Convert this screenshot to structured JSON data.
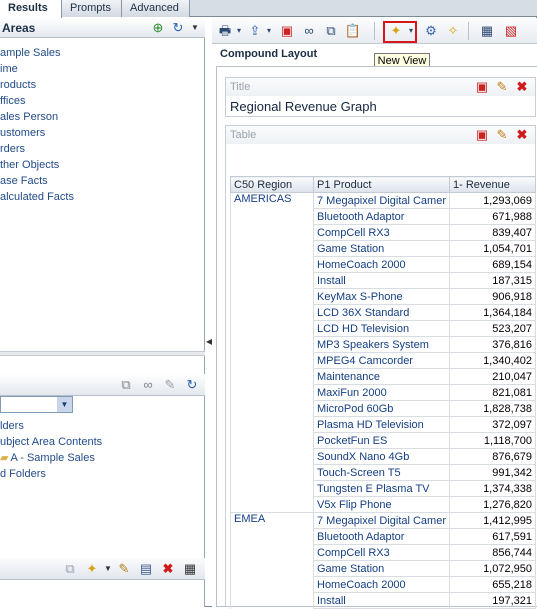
{
  "tabs": [
    {
      "label": "Results"
    },
    {
      "label": "Prompts"
    },
    {
      "label": "Advanced"
    }
  ],
  "left_panel": {
    "subject_areas_title": "Areas",
    "subject_area_items": [
      "ample Sales",
      "ime",
      "roducts",
      "ffices",
      "ales Person",
      "ustomers",
      "rders",
      "ther Objects",
      "ase Facts",
      "alculated Facts"
    ],
    "catalog_items": [
      "lders",
      "ubject Area Contents",
      "A - Sample Sales",
      "d Folders"
    ]
  },
  "toolbar": {
    "tooltip": "New View"
  },
  "compound_layout": {
    "title": "Compound Layout",
    "title_view": {
      "label": "Title",
      "text": "Regional Revenue Graph"
    },
    "table_view": {
      "label": "Table"
    }
  },
  "table": {
    "columns": [
      "C50 Region",
      "P1 Product",
      "1- Revenue"
    ],
    "groups": [
      {
        "region": "AMERICAS",
        "rows": [
          {
            "product": "7 Megapixel Digital Camer",
            "revenue": "1,293,069"
          },
          {
            "product": "Bluetooth Adaptor",
            "revenue": "671,988"
          },
          {
            "product": "CompCell RX3",
            "revenue": "839,407"
          },
          {
            "product": "Game Station",
            "revenue": "1,054,701"
          },
          {
            "product": "HomeCoach 2000",
            "revenue": "689,154"
          },
          {
            "product": "Install",
            "revenue": "187,315"
          },
          {
            "product": "KeyMax S-Phone",
            "revenue": "906,918"
          },
          {
            "product": "LCD 36X Standard",
            "revenue": "1,364,184"
          },
          {
            "product": "LCD HD Television",
            "revenue": "523,207"
          },
          {
            "product": "MP3 Speakers System",
            "revenue": "376,816"
          },
          {
            "product": "MPEG4 Camcorder",
            "revenue": "1,340,402"
          },
          {
            "product": "Maintenance",
            "revenue": "210,047"
          },
          {
            "product": "MaxiFun 2000",
            "revenue": "821,081"
          },
          {
            "product": "MicroPod 60Gb",
            "revenue": "1,828,738"
          },
          {
            "product": "Plasma HD Television",
            "revenue": "372,097"
          },
          {
            "product": "PocketFun ES",
            "revenue": "1,118,700"
          },
          {
            "product": "SoundX Nano 4Gb",
            "revenue": "876,679"
          },
          {
            "product": "Touch-Screen T5",
            "revenue": "991,342"
          },
          {
            "product": "Tungsten E Plasma TV",
            "revenue": "1,374,338"
          },
          {
            "product": "V5x Flip Phone",
            "revenue": "1,276,820"
          }
        ]
      },
      {
        "region": "EMEA",
        "rows": [
          {
            "product": "7 Megapixel Digital Camer",
            "revenue": "1,412,995"
          },
          {
            "product": "Bluetooth Adaptor",
            "revenue": "617,591"
          },
          {
            "product": "CompCell RX3",
            "revenue": "856,744"
          },
          {
            "product": "Game Station",
            "revenue": "1,072,950"
          },
          {
            "product": "HomeCoach 2000",
            "revenue": "655,218"
          },
          {
            "product": "Install",
            "revenue": "197,321"
          }
        ]
      }
    ]
  }
}
